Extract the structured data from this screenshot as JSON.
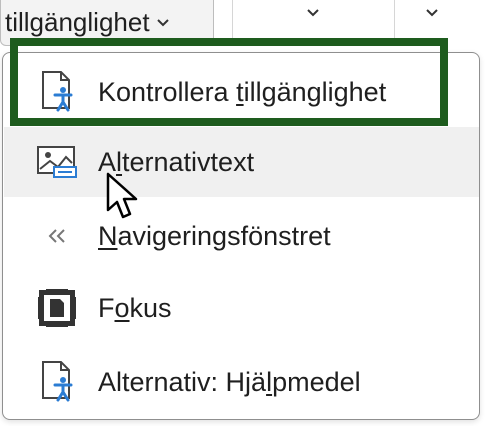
{
  "ribbon": {
    "button_label": "tillgänglighet",
    "caret_icon": "chevron-down-icon"
  },
  "menu": {
    "items": [
      {
        "label_pre": "Kontrollera ",
        "mnemonic": "t",
        "label_post": "illgänglighet",
        "icon": "accessibility-check-icon",
        "focused": true
      },
      {
        "label_pre": "A",
        "mnemonic": "l",
        "label_post": "ternativtext",
        "icon": "alt-text-icon",
        "hovered": true
      },
      {
        "label_pre": "",
        "mnemonic": "N",
        "label_post": "avigeringsfönstret",
        "icon": "navigation-pane-icon"
      },
      {
        "label_pre": "F",
        "mnemonic": "o",
        "label_post": "kus",
        "icon": "focus-icon"
      },
      {
        "label_pre": "Alternativ: Hjä",
        "mnemonic": "l",
        "label_post": "pmedel",
        "icon": "accessibility-options-icon"
      }
    ]
  },
  "colors": {
    "focus_outline": "#1e5c1e",
    "icon_blue": "#2b7cd3",
    "icon_gray": "#444444",
    "hover_bg": "#f0f0f0"
  }
}
